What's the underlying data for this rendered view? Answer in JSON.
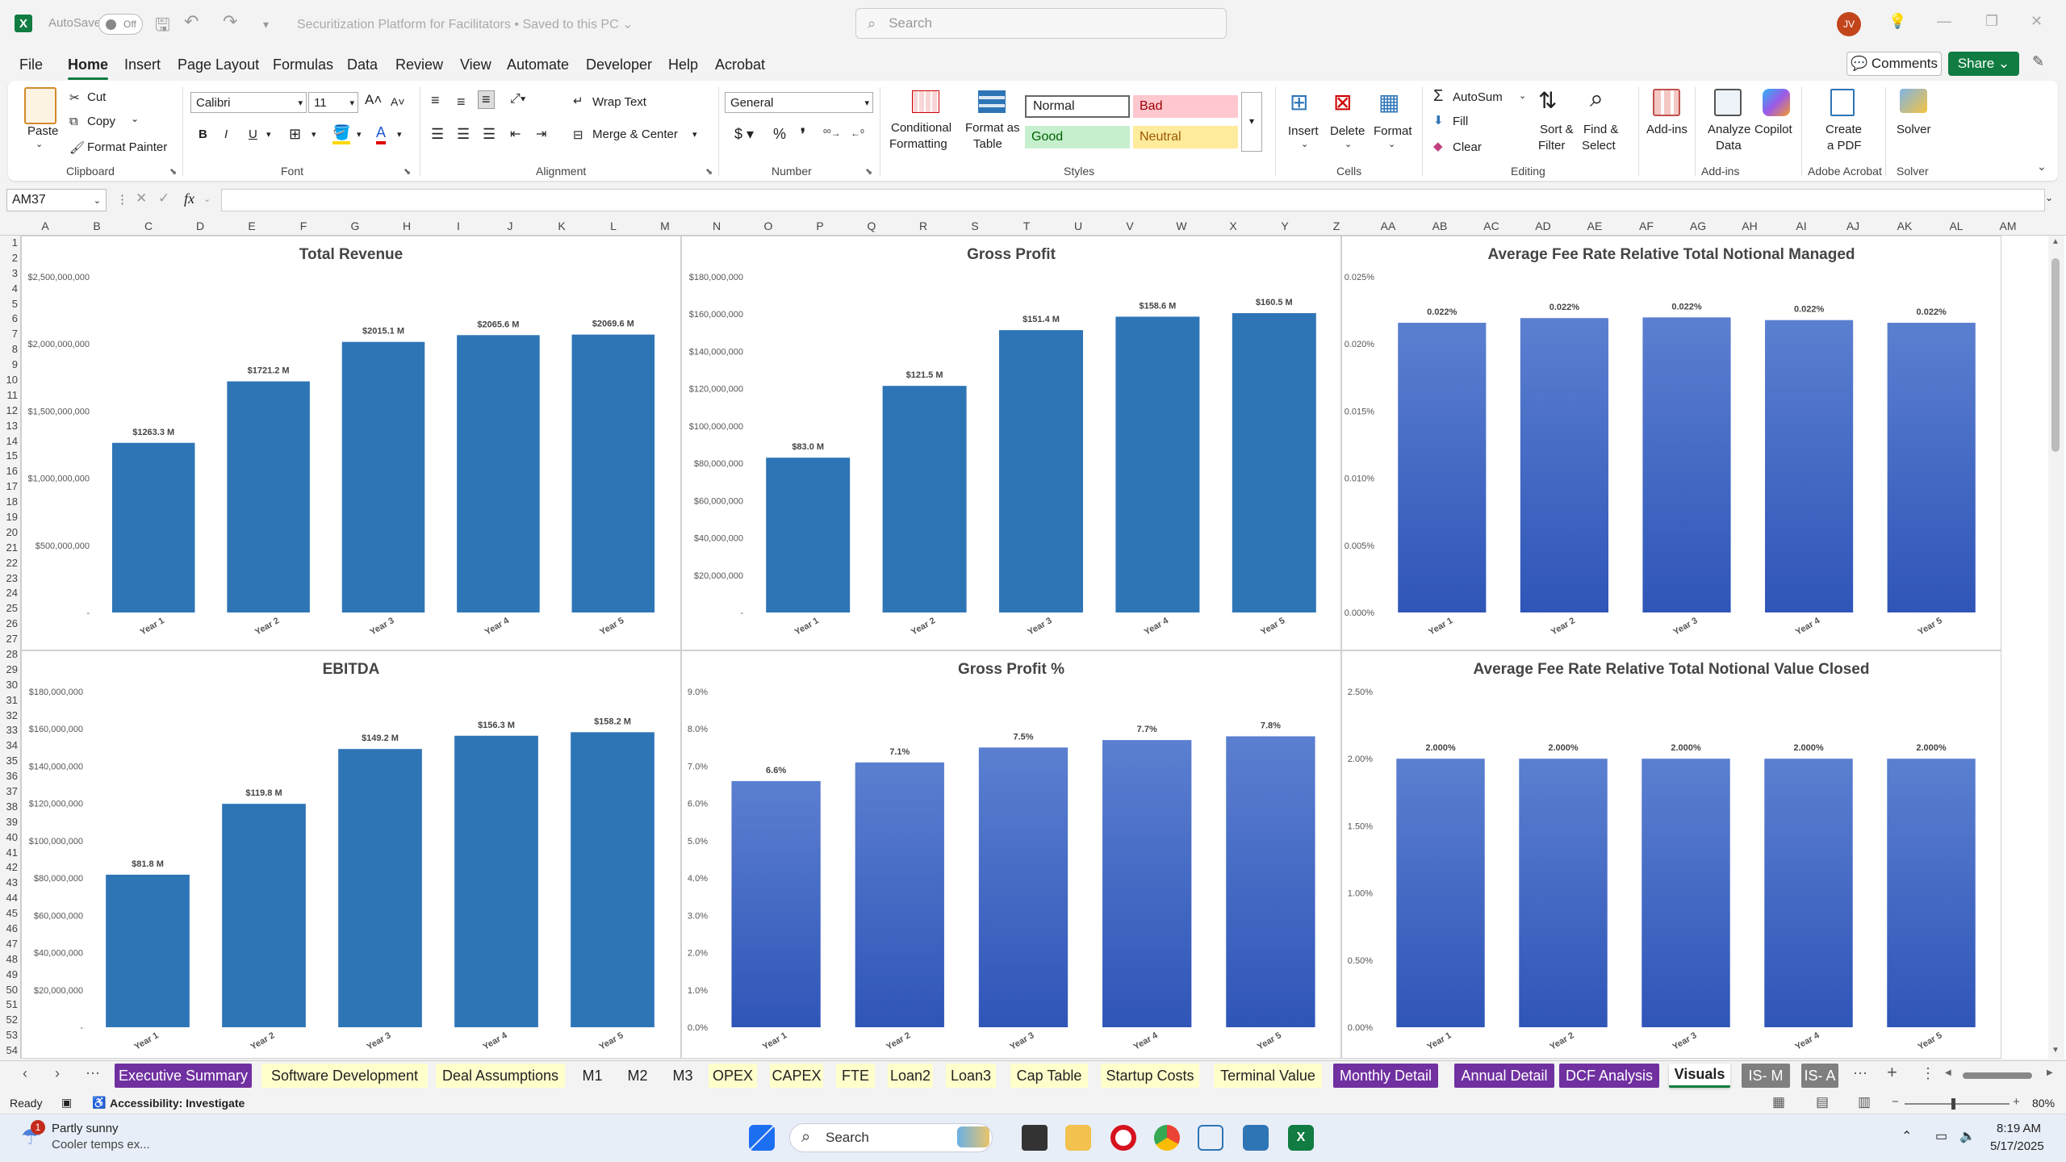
{
  "titlebar": {
    "autosave_label": "AutoSave",
    "autosave_state": "Off",
    "doc_title": "Securitization Platform for Facilitators • Saved to this PC ⌄",
    "search_placeholder": "Search",
    "user_initials": "JV"
  },
  "menu": [
    "File",
    "Home",
    "Insert",
    "Page Layout",
    "Formulas",
    "Data",
    "Review",
    "View",
    "Automate",
    "Developer",
    "Help",
    "Acrobat"
  ],
  "menu_active": "Home",
  "top_buttons": {
    "comments": "Comments",
    "share": "Share"
  },
  "ribbon": {
    "clipboard": {
      "paste": "Paste",
      "cut": "Cut",
      "copy": "Copy",
      "format_painter": "Format Painter",
      "label": "Clipboard"
    },
    "font": {
      "name": "Calibri",
      "size": "11",
      "label": "Font"
    },
    "alignment": {
      "wrap": "Wrap Text",
      "merge": "Merge & Center",
      "label": "Alignment"
    },
    "number": {
      "format": "General",
      "label": "Number"
    },
    "styles": {
      "conditional": "Conditional",
      "conditional2": "Formatting",
      "format_as": "Format as",
      "format_as2": "Table",
      "normal": "Normal",
      "bad": "Bad",
      "good": "Good",
      "neutral": "Neutral",
      "label": "Styles"
    },
    "cells": {
      "insert": "Insert",
      "delete": "Delete",
      "format": "Format",
      "label": "Cells"
    },
    "editing": {
      "autosum": "AutoSum",
      "fill": "Fill",
      "clear": "Clear",
      "sort": "Sort &",
      "sort2": "Filter",
      "find": "Find &",
      "find2": "Select",
      "label": "Editing"
    },
    "addins": {
      "addins": "Add-ins",
      "analyze": "Analyze",
      "analyze2": "Data",
      "copilot": "Copilot",
      "label": "Add-ins"
    },
    "acrobat": {
      "create": "Create",
      "create2": "a PDF",
      "label": "Adobe Acrobat"
    },
    "solver": {
      "solver": "Solver",
      "label": "Solver"
    }
  },
  "formula_bar": {
    "name_box": "AM37",
    "fx": "fx"
  },
  "columns": [
    "A",
    "B",
    "C",
    "D",
    "E",
    "F",
    "G",
    "H",
    "I",
    "J",
    "K",
    "L",
    "M",
    "N",
    "O",
    "P",
    "Q",
    "R",
    "S",
    "T",
    "U",
    "V",
    "W",
    "X",
    "Y",
    "Z",
    "AA",
    "AB",
    "AC",
    "AD",
    "AE",
    "AF",
    "AG",
    "AH",
    "AI",
    "AJ",
    "AK",
    "AL",
    "AM"
  ],
  "rows": [
    "1",
    "2",
    "3",
    "4",
    "5",
    "6",
    "7",
    "8",
    "9",
    "10",
    "11",
    "12",
    "13",
    "14",
    "15",
    "16",
    "17",
    "18",
    "19",
    "20",
    "21",
    "22",
    "23",
    "24",
    "25",
    "26",
    "27",
    "28",
    "29",
    "30",
    "31",
    "32",
    "33",
    "34",
    "35",
    "36",
    "37",
    "38",
    "39",
    "40",
    "41",
    "42",
    "43",
    "44",
    "45",
    "46",
    "47",
    "48",
    "49",
    "50",
    "51",
    "52",
    "53",
    "54"
  ],
  "chart_data": [
    {
      "type": "bar",
      "title": "Total Revenue",
      "categories": [
        "Year 1",
        "Year 2",
        "Year 3",
        "Year 4",
        "Year 5"
      ],
      "values": [
        1263.3,
        1721.2,
        2015.1,
        2065.6,
        2069.6
      ],
      "data_labels": [
        "$1263.3 M",
        "$1721.2 M",
        "$2015.1 M",
        "$2065.6 M",
        "$2069.6 M"
      ],
      "ylim": [
        0,
        2500000000
      ],
      "yticks": [
        "-",
        "$500,000,000",
        "$1,000,000,000",
        "$1,500,000,000",
        "$2,000,000,000",
        "$2,500,000,000"
      ],
      "value_scale": 1000000,
      "color": "#2e75b6",
      "gradient": false
    },
    {
      "type": "bar",
      "title": "Gross Profit",
      "categories": [
        "Year 1",
        "Year 2",
        "Year 3",
        "Year 4",
        "Year 5"
      ],
      "values": [
        83.0,
        121.5,
        151.4,
        158.6,
        160.5
      ],
      "data_labels": [
        "$83.0 M",
        "$121.5 M",
        "$151.4 M",
        "$158.6 M",
        "$160.5 M"
      ],
      "ylim": [
        0,
        180000000
      ],
      "yticks": [
        "-",
        "$20,000,000",
        "$40,000,000",
        "$60,000,000",
        "$80,000,000",
        "$100,000,000",
        "$120,000,000",
        "$140,000,000",
        "$160,000,000",
        "$180,000,000"
      ],
      "value_scale": 1000000,
      "color": "#2e75b6",
      "gradient": false
    },
    {
      "type": "bar",
      "title": "Average Fee Rate Relative Total Notional Managed",
      "categories": [
        "Year 1",
        "Year 2",
        "Year 3",
        "Year 4",
        "Year 5"
      ],
      "values": [
        0.022,
        0.022,
        0.022,
        0.022,
        0.022
      ],
      "data_labels": [
        "0.022%",
        "0.022%",
        "0.022%",
        "0.022%",
        "0.022%"
      ],
      "ylim": [
        0,
        0.025
      ],
      "yticks": [
        "0.000%",
        "0.005%",
        "0.010%",
        "0.015%",
        "0.020%",
        "0.025%"
      ],
      "value_scale": 1,
      "bar_fracs": [
        0.863,
        0.877,
        0.879,
        0.871,
        0.863
      ],
      "color": "#4472c4",
      "gradient": true
    },
    {
      "type": "bar",
      "title": "EBITDA",
      "categories": [
        "Year 1",
        "Year 2",
        "Year 3",
        "Year 4",
        "Year 5"
      ],
      "values": [
        81.8,
        119.8,
        149.2,
        156.3,
        158.2
      ],
      "data_labels": [
        "$81.8 M",
        "$119.8 M",
        "$149.2 M",
        "$156.3 M",
        "$158.2 M"
      ],
      "ylim": [
        0,
        180000000
      ],
      "yticks": [
        "-",
        "$20,000,000",
        "$40,000,000",
        "$60,000,000",
        "$80,000,000",
        "$100,000,000",
        "$120,000,000",
        "$140,000,000",
        "$160,000,000",
        "$180,000,000"
      ],
      "value_scale": 1000000,
      "color": "#2e75b6",
      "gradient": false
    },
    {
      "type": "bar",
      "title": "Gross Profit %",
      "categories": [
        "Year 1",
        "Year 2",
        "Year 3",
        "Year 4",
        "Year 5"
      ],
      "values": [
        6.6,
        7.1,
        7.5,
        7.7,
        7.8
      ],
      "data_labels": [
        "6.6%",
        "7.1%",
        "7.5%",
        "7.7%",
        "7.8%"
      ],
      "ylim": [
        0,
        9
      ],
      "yticks": [
        "0.0%",
        "1.0%",
        "2.0%",
        "3.0%",
        "4.0%",
        "5.0%",
        "6.0%",
        "7.0%",
        "8.0%",
        "9.0%"
      ],
      "value_scale": 1,
      "color": "#4472c4",
      "gradient": true
    },
    {
      "type": "bar",
      "title": "Average Fee Rate Relative Total Notional Value Closed",
      "categories": [
        "Year 1",
        "Year 2",
        "Year 3",
        "Year 4",
        "Year 5"
      ],
      "values": [
        2.0,
        2.0,
        2.0,
        2.0,
        2.0
      ],
      "data_labels": [
        "2.000%",
        "2.000%",
        "2.000%",
        "2.000%",
        "2.000%"
      ],
      "ylim": [
        0,
        2.5
      ],
      "yticks": [
        "0.00%",
        "0.50%",
        "1.00%",
        "1.50%",
        "2.00%",
        "2.50%"
      ],
      "value_scale": 1,
      "color": "#4472c4",
      "gradient": true
    }
  ],
  "sheet_tabs": [
    {
      "label": "Executive Summary",
      "bg": "#7030a0",
      "fg": "#ffffff"
    },
    {
      "label": "Software Development",
      "bg": "#ffffcc",
      "fg": "#222222"
    },
    {
      "label": "Deal Assumptions",
      "bg": "#ffffcc",
      "fg": "#222222"
    },
    {
      "label": "M1",
      "bg": "#f3f3f3",
      "fg": "#222222"
    },
    {
      "label": "M2",
      "bg": "#f3f3f3",
      "fg": "#222222"
    },
    {
      "label": "M3",
      "bg": "#f3f3f3",
      "fg": "#222222"
    },
    {
      "label": "OPEX",
      "bg": "#ffffcc",
      "fg": "#222222"
    },
    {
      "label": "CAPEX",
      "bg": "#ffffcc",
      "fg": "#222222"
    },
    {
      "label": "FTE",
      "bg": "#ffffcc",
      "fg": "#222222"
    },
    {
      "label": "Loan2",
      "bg": "#ffffcc",
      "fg": "#222222"
    },
    {
      "label": "Loan3",
      "bg": "#ffffcc",
      "fg": "#222222"
    },
    {
      "label": "Cap Table",
      "bg": "#ffffcc",
      "fg": "#222222"
    },
    {
      "label": "Startup Costs",
      "bg": "#ffffcc",
      "fg": "#222222"
    },
    {
      "label": "Terminal Value",
      "bg": "#ffffcc",
      "fg": "#222222"
    },
    {
      "label": "Monthly Detail",
      "bg": "#7030a0",
      "fg": "#ffffff"
    },
    {
      "label": "Annual Detail",
      "bg": "#7030a0",
      "fg": "#ffffff"
    },
    {
      "label": "DCF Analysis",
      "bg": "#7030a0",
      "fg": "#ffffff"
    },
    {
      "label": "Visuals",
      "bg": "#ffffff",
      "fg": "#222222"
    },
    {
      "label": "IS- M",
      "bg": "#7f7f7f",
      "fg": "#ffffff"
    },
    {
      "label": "IS- A",
      "bg": "#7f7f7f",
      "fg": "#ffffff"
    }
  ],
  "active_tab": "Visuals",
  "status": {
    "ready": "Ready",
    "accessibility": "Accessibility: Investigate",
    "zoom": "80%"
  },
  "taskbar": {
    "weather1": "Partly sunny",
    "weather2": "Cooler temps ex...",
    "search": "Search",
    "time": "8:19 AM",
    "date": "5/17/2025",
    "badge": "1"
  }
}
